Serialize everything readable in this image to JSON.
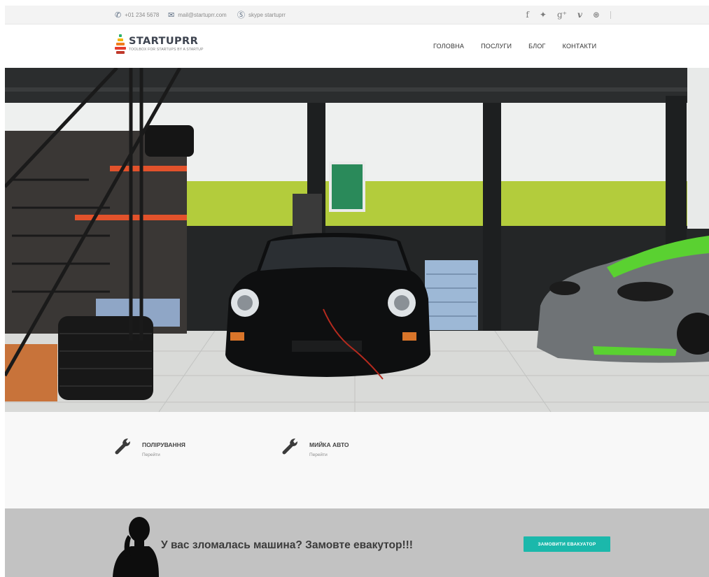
{
  "topbar": {
    "phone": "+01 234 5678",
    "email": "mail@startuprr.com",
    "skype": "skype startuprr",
    "social_icons": [
      "facebook-icon",
      "twitter-icon",
      "google-plus-icon",
      "vimeo-icon",
      "dribbble-icon"
    ],
    "social_glyphs": [
      "f",
      "✦",
      "g⁺",
      "v",
      "⊛"
    ]
  },
  "logo": {
    "name": "STARTUPRR",
    "tagline": "TOOLBOX FOR STARTUPS BY A STARTUP"
  },
  "nav": {
    "items": [
      "ГОЛОВНА",
      "ПОСЛУГИ",
      "БЛОГ",
      "КОНТАКТИ"
    ]
  },
  "services": {
    "items": [
      {
        "title": "ПОЛІРУВАННЯ",
        "link": "Перейти"
      },
      {
        "title": "МИЙКА АВТО",
        "link": "Перейти"
      }
    ]
  },
  "cta": {
    "text": "У вас зломалась машина? Замовте евакутор!!!",
    "button": "ЗАМОВИТИ ЕВАКУАТОР"
  },
  "colors": {
    "accent": "#1bb8ab",
    "topbar_bg": "#f3f3f3",
    "cta_bg": "#c2c2c2",
    "wall_green": "#b3cc3c"
  }
}
